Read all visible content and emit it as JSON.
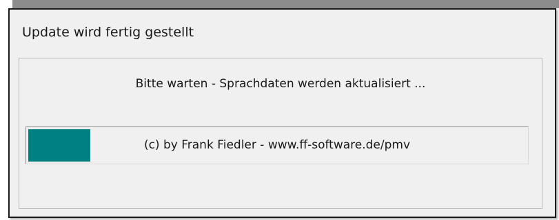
{
  "window": {
    "title": "Update wird fertig gestellt"
  },
  "dialog": {
    "message": "Bitte warten - Sprachdaten werden aktualisiert ...",
    "progress_text": "(c) by Frank Fiedler - www.ff-software.de/pmv",
    "progress_fraction": 0.125
  },
  "colors": {
    "progress_fill": "#008080",
    "dialog_background": "#f0f0f0",
    "window_border": "#1b1b1b"
  }
}
